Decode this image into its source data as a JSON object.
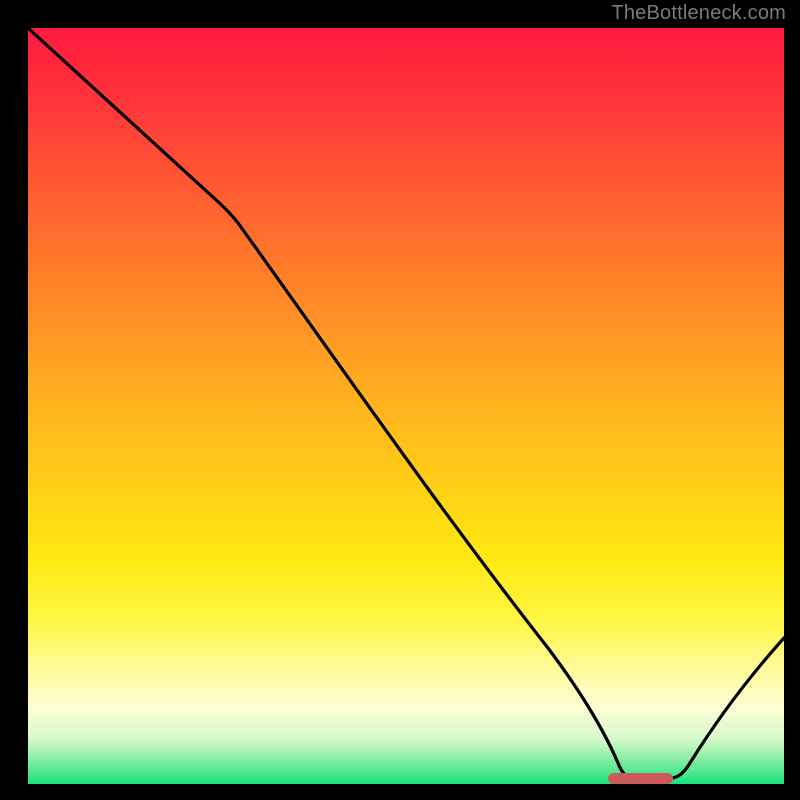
{
  "watermark": "TheBottleneck.com",
  "chart_data": {
    "type": "line",
    "title": "",
    "xlabel": "",
    "ylabel": "",
    "xlim": [
      0,
      100
    ],
    "ylim": [
      0,
      100
    ],
    "grid": false,
    "legend": "none",
    "gradient_colors_top_to_bottom": [
      "#ff1a40",
      "#ffb41e",
      "#fff640",
      "#19e37d"
    ],
    "series": [
      {
        "name": "bottleneck-curve",
        "color": "#000000",
        "x": [
          0,
          10,
          20,
          25,
          30,
          40,
          50,
          60,
          70,
          76,
          80,
          84,
          90,
          100
        ],
        "y": [
          100,
          92,
          83,
          78,
          72,
          58,
          45,
          31,
          16,
          5,
          0.5,
          0.5,
          5,
          17
        ]
      }
    ],
    "marker": {
      "name": "optimal-range",
      "shape": "rounded-bar",
      "color": "#cc5a5a",
      "x_start": 77,
      "x_end": 85,
      "y": 0.5
    }
  }
}
